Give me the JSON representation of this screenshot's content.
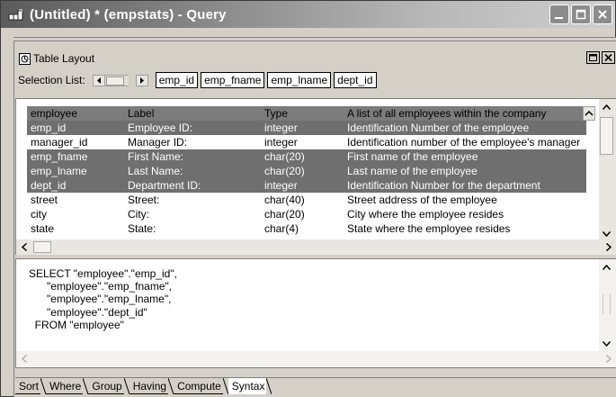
{
  "window": {
    "title": "(Untitled) * (empstats) - Query"
  },
  "panel": {
    "title": "Table Layout"
  },
  "selection": {
    "label": "Selection List:",
    "items": [
      "emp_id",
      "emp_fname",
      "emp_lname",
      "dept_id"
    ]
  },
  "grid": {
    "headers": [
      "employee",
      "Label",
      "Type",
      "A list of all employees within the company"
    ],
    "rows": [
      {
        "name": "emp_id",
        "label": "Employee ID:",
        "type": "integer",
        "desc": "Identification Number of the employee",
        "selected": true
      },
      {
        "name": "manager_id",
        "label": "Manager ID:",
        "type": "integer",
        "desc": "Identification number of the employee's manager",
        "selected": false
      },
      {
        "name": "emp_fname",
        "label": "First Name:",
        "type": "char(20)",
        "desc": "First name of the employee",
        "selected": true
      },
      {
        "name": "emp_lname",
        "label": "Last Name:",
        "type": "char(20)",
        "desc": "Last name of the employee",
        "selected": true
      },
      {
        "name": "dept_id",
        "label": "Department ID:",
        "type": "integer",
        "desc": "Identification Number for the department",
        "selected": true
      },
      {
        "name": "street",
        "label": "Street:",
        "type": "char(40)",
        "desc": "Street address of the employee",
        "selected": false
      },
      {
        "name": "city",
        "label": "City:",
        "type": "char(20)",
        "desc": "City where the employee resides",
        "selected": false
      },
      {
        "name": "state",
        "label": "State:",
        "type": "char(4)",
        "desc": "State where the employee resides",
        "selected": false
      }
    ]
  },
  "sql": {
    "text": "SELECT \"employee\".\"emp_id\",\n      \"employee\".\"emp_fname\",\n      \"employee\".\"emp_lname\",\n      \"employee\".\"dept_id\"\n  FROM \"employee\""
  },
  "tabs": [
    {
      "label": "Sort",
      "active": false
    },
    {
      "label": "Where",
      "active": false
    },
    {
      "label": "Group",
      "active": false
    },
    {
      "label": "Having",
      "active": false
    },
    {
      "label": "Compute",
      "active": false
    },
    {
      "label": "Syntax",
      "active": true
    }
  ],
  "colors": {
    "selected_row": "#6f6f6f",
    "header_row": "#7c7c7c",
    "titlebar_start": "#5b5b5b"
  }
}
